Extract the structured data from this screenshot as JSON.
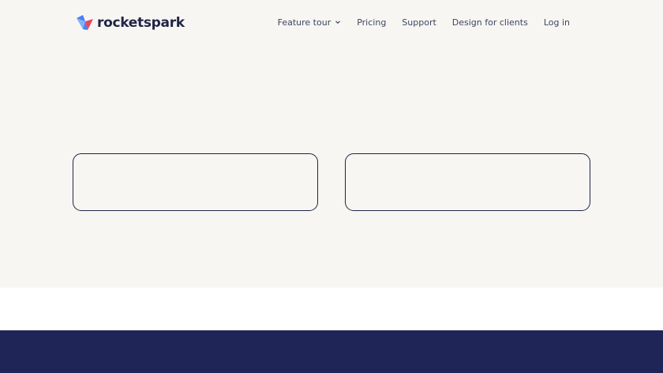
{
  "brand": {
    "name": "rocketspark",
    "text_color": "#1f2547",
    "logo_colors": [
      "#e9455e",
      "#4a7ef2",
      "#7fb2f7"
    ]
  },
  "nav": {
    "items": [
      {
        "label": "Feature tour",
        "icon": "chevron-down-icon"
      },
      {
        "label": "Pricing"
      },
      {
        "label": "Support"
      },
      {
        "label": "Design for clients"
      },
      {
        "label": "Log in"
      }
    ]
  },
  "colors": {
    "hero_background": "#f8f6f2",
    "card_border": "#1f2547",
    "footer_background": "#1f2557"
  }
}
